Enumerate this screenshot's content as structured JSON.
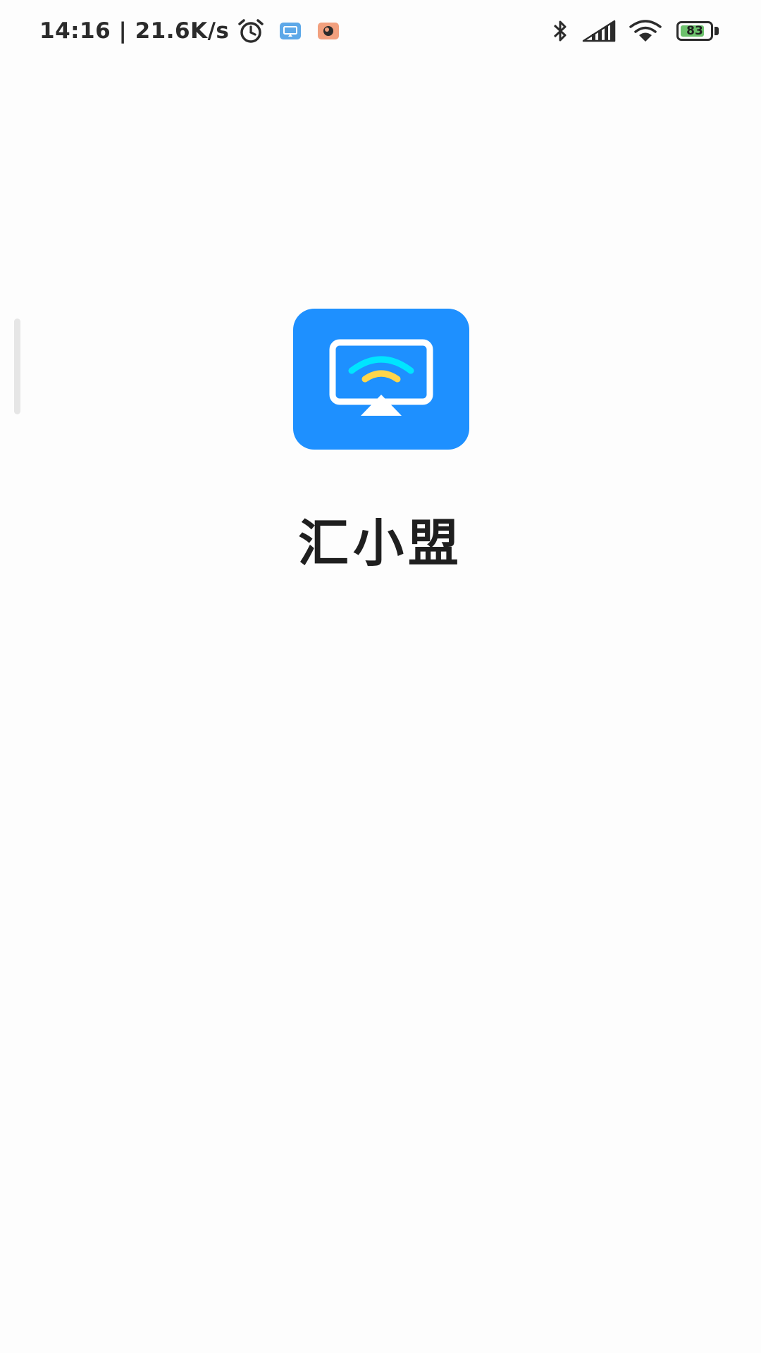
{
  "status_bar": {
    "time_speed": "14:16 | 21.6K/s",
    "battery_level": "83",
    "battery_percent": 83,
    "icons": [
      "alarm-icon",
      "screen-cast-notification-icon",
      "app-notification-icon",
      "bluetooth-icon",
      "cellular-signal-icon",
      "wifi-icon",
      "battery-icon"
    ]
  },
  "splash": {
    "app_name": "汇小盟",
    "logo_icon": "screen-mirror-icon"
  },
  "colors": {
    "logo_bg": "#1e90ff",
    "wave_outer": "#00e5ff",
    "wave_inner": "#ffd54a",
    "battery_fill": "#6cc16c"
  }
}
